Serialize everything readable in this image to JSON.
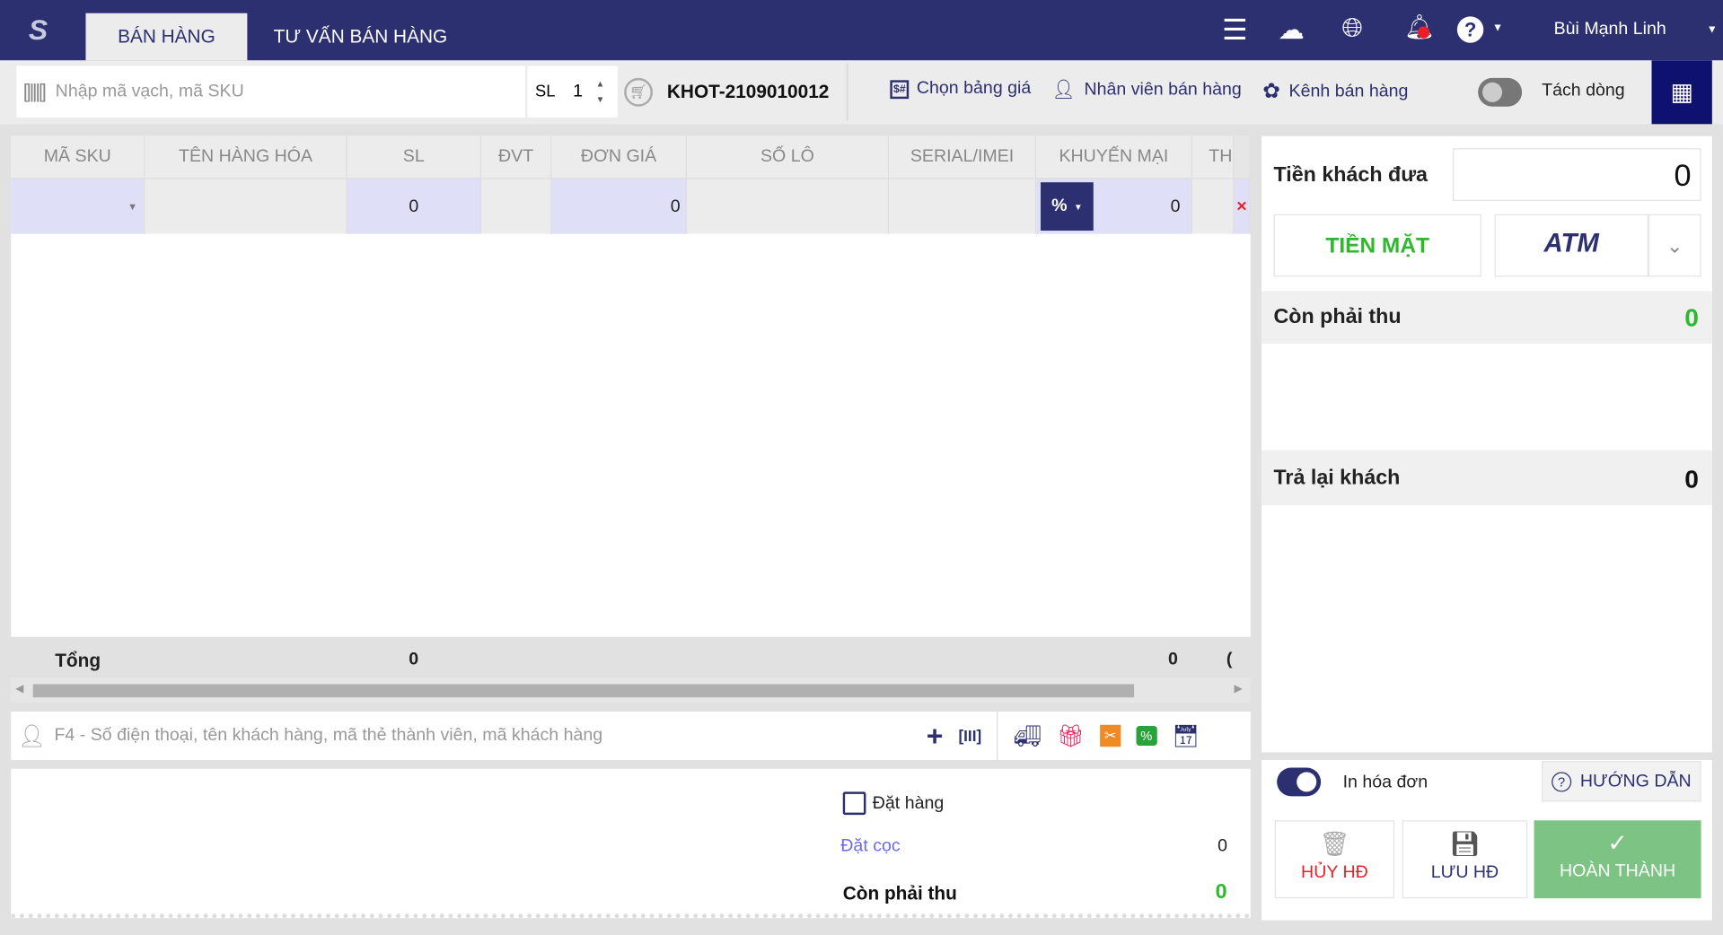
{
  "header": {
    "tabs": [
      {
        "label": "BÁN HÀNG",
        "active": true
      },
      {
        "label": "TƯ VẤN BÁN HÀNG",
        "active": false
      }
    ],
    "user_name": "Bùi Mạnh Linh"
  },
  "toolbar": {
    "search_placeholder": "Nhập mã vạch, mã SKU",
    "qty_label": "SL",
    "qty_value": "1",
    "invoice_code": "KHOT-2109010012",
    "price_list": "Chọn bảng giá",
    "sales_staff": "Nhân viên bán hàng",
    "sales_channel": "Kênh bán hàng",
    "split_line": "Tách dòng",
    "split_line_on": false
  },
  "table": {
    "columns": [
      "MÃ SKU",
      "TÊN HÀNG HÓA",
      "SL",
      "ĐVT",
      "ĐƠN GIÁ",
      "SỐ LÔ",
      "SERIAL/IMEI",
      "KHUYẾN MẠI",
      "TH"
    ],
    "row": {
      "sl": "0",
      "don_gia": "0",
      "discount_type": "%",
      "discount_value": "0"
    },
    "total_label": "Tổng",
    "total_sl": "0",
    "total_km": "0",
    "total_partial": "("
  },
  "customer": {
    "placeholder": "F4 - Số điện thoại, tên khách hàng, mã thẻ thành viên, mã khách hàng"
  },
  "order": {
    "dat_hang": "Đặt hàng",
    "dat_coc": "Đặt cọc",
    "dat_coc_value": "0",
    "con_phai_thu": "Còn phải thu",
    "con_phai_thu_value": "0"
  },
  "payment": {
    "tien_khach_dua": "Tiền khách đưa",
    "tien_khach_dua_value": "0",
    "cash": "TIỀN MẶT",
    "atm": "ATM",
    "con_phai_thu": "Còn phải thu",
    "con_phai_thu_value": "0",
    "tra_lai_khach": "Trả lại khách",
    "tra_lai_khach_value": "0",
    "in_hoa_don": "In hóa đơn",
    "in_hoa_don_on": true,
    "huong_dan": "HƯỚNG DẪN",
    "huy": "HỦY HĐ",
    "luu": "LƯU HĐ",
    "hoan_thanh": "HOÀN THÀNH"
  },
  "colors": {
    "navy": "#2d3070",
    "green": "#2eb82e",
    "red": "#e8202a",
    "complete": "#7dc383"
  }
}
